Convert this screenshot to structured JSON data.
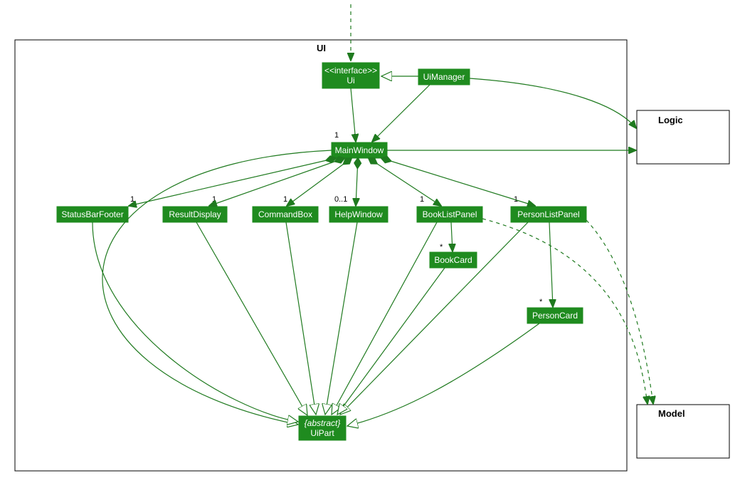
{
  "diagram_kind": "UML class diagram",
  "packages": {
    "ui": {
      "label": "UI"
    },
    "logic": {
      "label": "Logic"
    },
    "model": {
      "label": "Model"
    }
  },
  "nodes": {
    "ui_interface": {
      "stereotype": "<<interface>>",
      "name": "Ui"
    },
    "ui_manager": {
      "name": "UiManager"
    },
    "main_window": {
      "name": "MainWindow"
    },
    "status_bar_footer": {
      "name": "StatusBarFooter"
    },
    "result_display": {
      "name": "ResultDisplay"
    },
    "command_box": {
      "name": "CommandBox"
    },
    "help_window": {
      "name": "HelpWindow"
    },
    "book_list_panel": {
      "name": "BookListPanel"
    },
    "person_list_panel": {
      "name": "PersonListPanel"
    },
    "book_card": {
      "name": "BookCard"
    },
    "person_card": {
      "name": "PersonCard"
    },
    "ui_part": {
      "stereotype": "{abstract}",
      "name": "UiPart"
    }
  },
  "multiplicities": {
    "mw": "1",
    "sbf": "1",
    "rd": "1",
    "cb": "1",
    "hw": "0..1",
    "blp": "1",
    "plp": "1",
    "bc": "*",
    "pc": "*"
  },
  "edges": [
    {
      "from": "(external)",
      "to": "Ui",
      "style": "dependency"
    },
    {
      "from": "UiManager",
      "to": "Ui",
      "style": "realization"
    },
    {
      "from": "UiManager",
      "to": "MainWindow",
      "style": "association",
      "mult": "1"
    },
    {
      "from": "MainWindow",
      "to": "StatusBarFooter",
      "style": "composition",
      "mult": "1"
    },
    {
      "from": "MainWindow",
      "to": "ResultDisplay",
      "style": "composition",
      "mult": "1"
    },
    {
      "from": "MainWindow",
      "to": "CommandBox",
      "style": "composition",
      "mult": "1"
    },
    {
      "from": "MainWindow",
      "to": "HelpWindow",
      "style": "composition",
      "mult": "0..1"
    },
    {
      "from": "MainWindow",
      "to": "BookListPanel",
      "style": "composition",
      "mult": "1"
    },
    {
      "from": "MainWindow",
      "to": "PersonListPanel",
      "style": "composition",
      "mult": "1"
    },
    {
      "from": "BookListPanel",
      "to": "BookCard",
      "style": "association",
      "mult": "*"
    },
    {
      "from": "PersonListPanel",
      "to": "PersonCard",
      "style": "association",
      "mult": "*"
    },
    {
      "from": "MainWindow",
      "to": "UiPart",
      "style": "generalization"
    },
    {
      "from": "StatusBarFooter",
      "to": "UiPart",
      "style": "generalization"
    },
    {
      "from": "ResultDisplay",
      "to": "UiPart",
      "style": "generalization"
    },
    {
      "from": "CommandBox",
      "to": "UiPart",
      "style": "generalization"
    },
    {
      "from": "HelpWindow",
      "to": "UiPart",
      "style": "generalization"
    },
    {
      "from": "BookListPanel",
      "to": "UiPart",
      "style": "generalization"
    },
    {
      "from": "PersonListPanel",
      "to": "UiPart",
      "style": "generalization"
    },
    {
      "from": "BookCard",
      "to": "UiPart",
      "style": "generalization"
    },
    {
      "from": "PersonCard",
      "to": "UiPart",
      "style": "generalization"
    },
    {
      "from": "UiManager",
      "to": "Logic",
      "style": "association"
    },
    {
      "from": "MainWindow",
      "to": "Logic",
      "style": "association"
    },
    {
      "from": "BookListPanel",
      "to": "Model",
      "style": "dependency"
    },
    {
      "from": "PersonListPanel",
      "to": "Model",
      "style": "dependency"
    }
  ]
}
